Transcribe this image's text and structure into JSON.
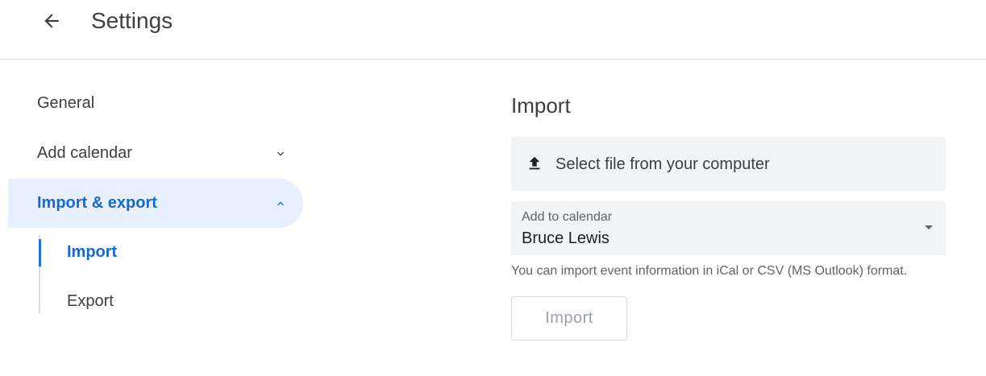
{
  "header": {
    "title": "Settings",
    "back_icon": "arrow-left-icon"
  },
  "sidebar": {
    "items": [
      {
        "label": "General",
        "chevron": null,
        "active": false
      },
      {
        "label": "Add calendar",
        "chevron": "chevron-down-icon",
        "active": false
      },
      {
        "label": "Import & export",
        "chevron": "chevron-up-icon",
        "active": true
      }
    ],
    "subitems": [
      {
        "label": "Import",
        "active": true
      },
      {
        "label": "Export",
        "active": false
      }
    ]
  },
  "main": {
    "section_title": "Import",
    "file_select": {
      "label": "Select file from your computer",
      "icon": "upload-icon"
    },
    "calendar_select": {
      "caption": "Add to calendar",
      "value": "Bruce Lewis",
      "icon": "dropdown-arrow-icon"
    },
    "hint": "You can import event information in iCal or CSV (MS Outlook) format.",
    "import_button": {
      "label": "Import",
      "disabled": true
    }
  },
  "colors": {
    "accent": "#1a73e8",
    "active_text": "#1967d2",
    "active_bg": "#e8f0fe",
    "field_bg": "#f1f3f4",
    "text": "#3c4043",
    "muted": "#5f6368",
    "divider": "#dadce0"
  }
}
